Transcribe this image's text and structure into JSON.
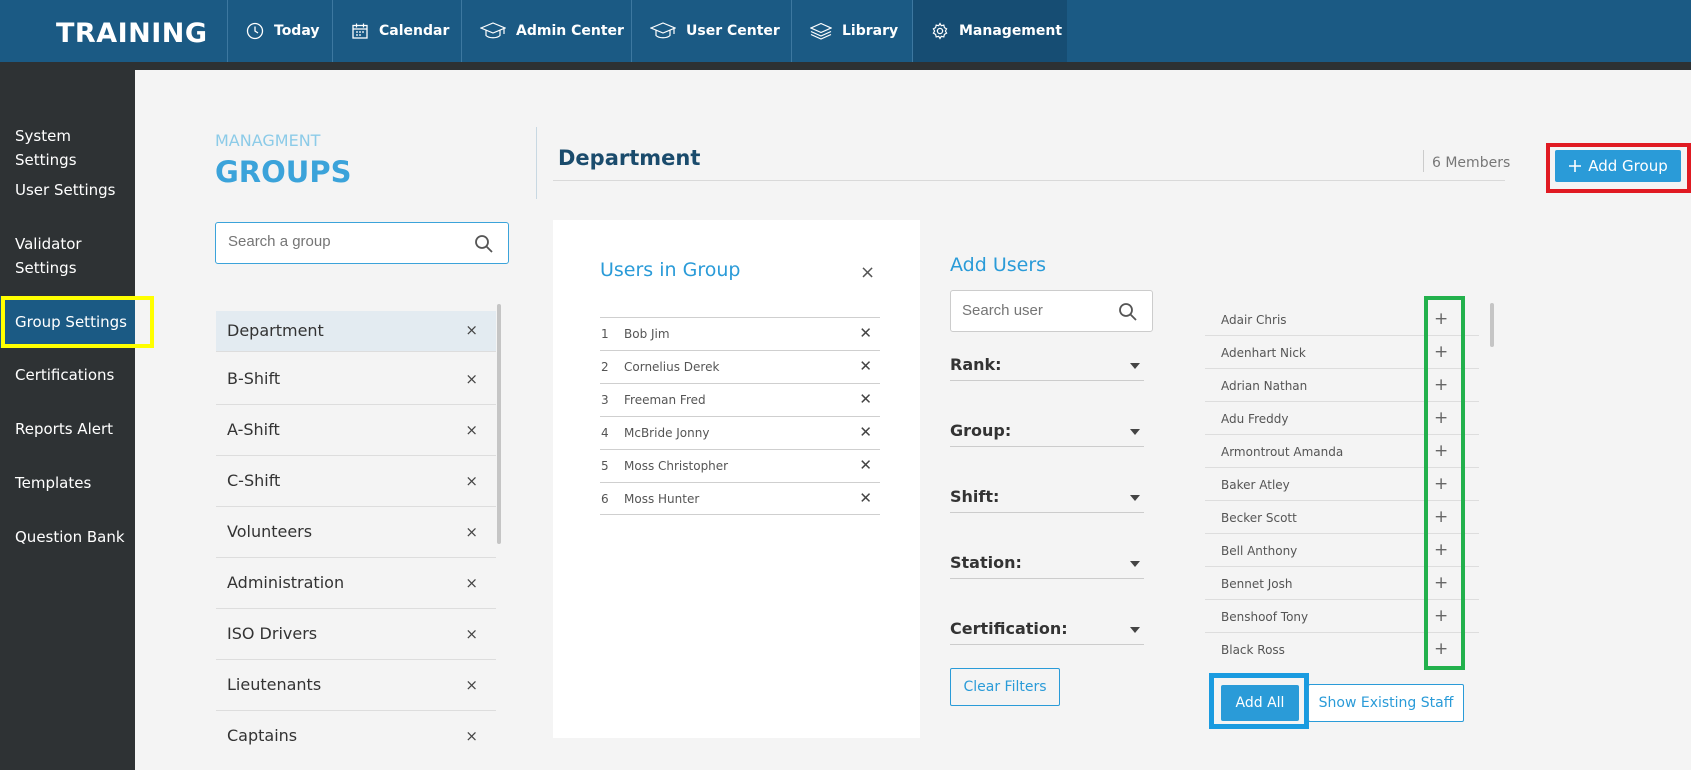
{
  "app": {
    "brand": "TRAINING"
  },
  "nav": [
    {
      "label": "Today",
      "icon": "clock-icon"
    },
    {
      "label": "Calendar",
      "icon": "calendar-icon"
    },
    {
      "label": "Admin Center",
      "icon": "graduation-cap-icon"
    },
    {
      "label": "User Center",
      "icon": "graduation-cap-icon"
    },
    {
      "label": "Library",
      "icon": "layers-icon"
    },
    {
      "label": "Management",
      "icon": "gear-icon",
      "active": true
    }
  ],
  "sidebar": {
    "items": [
      {
        "label": "System Settings"
      },
      {
        "label": "User Settings"
      },
      {
        "label": "Validator Settings"
      },
      {
        "label": "Group Settings",
        "active": true
      },
      {
        "label": "Certifications"
      },
      {
        "label": "Reports Alert"
      },
      {
        "label": "Templates"
      },
      {
        "label": "Question Bank"
      }
    ]
  },
  "groups_panel": {
    "eyebrow": "MANAGMENT",
    "title": "GROUPS",
    "search_placeholder": "Search a group",
    "groups": [
      {
        "label": "Department",
        "selected": true
      },
      {
        "label": "B-Shift"
      },
      {
        "label": "A-Shift"
      },
      {
        "label": "C-Shift"
      },
      {
        "label": "Volunteers"
      },
      {
        "label": "Administration"
      },
      {
        "label": "ISO Drivers"
      },
      {
        "label": "Lieutenants"
      },
      {
        "label": "Captains"
      }
    ],
    "remove_glyph": "×"
  },
  "detail": {
    "group_name": "Department",
    "members_count": "6 Members",
    "add_group_label": "Add Group"
  },
  "users_in_group": {
    "title": "Users in Group",
    "close_glyph": "×",
    "users": [
      {
        "num": "1",
        "name": "Bob Jim"
      },
      {
        "num": "2",
        "name": "Cornelius Derek"
      },
      {
        "num": "3",
        "name": "Freeman Fred"
      },
      {
        "num": "4",
        "name": "McBride Jonny"
      },
      {
        "num": "5",
        "name": "Moss Christopher"
      },
      {
        "num": "6",
        "name": "Moss Hunter"
      }
    ],
    "remove_glyph": "✕"
  },
  "add_users": {
    "title": "Add Users",
    "search_placeholder": "Search user",
    "filters": [
      {
        "label": "Rank:"
      },
      {
        "label": "Group:"
      },
      {
        "label": "Shift:"
      },
      {
        "label": "Station:"
      },
      {
        "label": "Certification:"
      }
    ],
    "clear_filters_label": "Clear Filters",
    "candidates": [
      "Adair Chris",
      "Adenhart Nick",
      "Adrian Nathan",
      "Adu Freddy",
      "Armontrout Amanda",
      "Baker Atley",
      "Becker Scott",
      "Bell Anthony",
      "Bennet Josh",
      "Benshoof Tony",
      "Black Ross"
    ],
    "add_glyph": "+",
    "add_all_label": "Add All",
    "show_existing_label": "Show Existing Staff"
  },
  "colors": {
    "topbar": "#1b5a84",
    "accent": "#2a9bd8",
    "sidebar": "#2e3234",
    "highlight_yellow": "#ffff00",
    "highlight_red": "#e01a22",
    "highlight_green": "#22b14c",
    "highlight_blue": "#1a9be0"
  }
}
